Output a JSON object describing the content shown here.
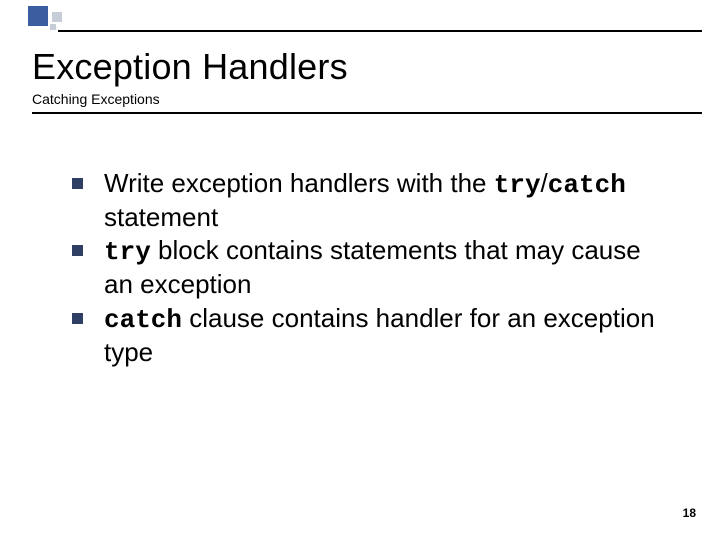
{
  "title": "Exception Handlers",
  "subtitle": "Catching Exceptions",
  "bullets": [
    {
      "pre": "Write exception handlers with the ",
      "code1": "try",
      "sep": "/",
      "code2": "catch",
      "post": " statement"
    },
    {
      "pre": "",
      "code1": "try",
      "sep": "",
      "code2": "",
      "post": "  block contains statements that may cause an exception"
    },
    {
      "pre": "",
      "code1": "catch",
      "sep": "",
      "code2": "",
      "post": " clause contains handler for an exception type"
    }
  ],
  "page_number": "18"
}
